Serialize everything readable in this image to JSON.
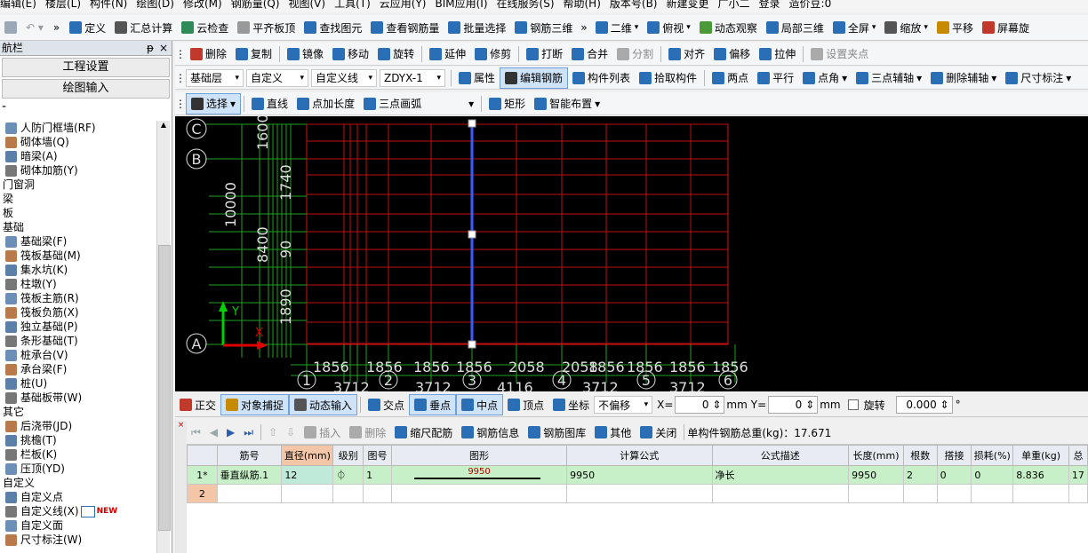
{
  "menubar": [
    "编辑(E)",
    "楼层(L)",
    "构件(N)",
    "绘图(D)",
    "修改(M)",
    "钢筋量(Q)",
    "视图(V)",
    "工具(T)",
    "云应用(Y)",
    "BIM应用(I)",
    "在线服务(S)",
    "帮助(H)",
    "版本号(B)",
    "新建变更",
    "广小二",
    "登录",
    "造价豆:0"
  ],
  "toolbar1": {
    "left": [
      "定义",
      "汇总计算",
      "云检查",
      "平齐板顶",
      "查找图元",
      "查看钢筋量",
      "批量选择",
      "钢筋三维"
    ],
    "right": [
      "二维",
      "俯视",
      "动态观察",
      "局部三维",
      "全屏",
      "缩放",
      "平移",
      "屏幕旋"
    ]
  },
  "panel": {
    "title": "航栏",
    "pin": "ᵽ",
    "close": "×",
    "buttons": [
      "工程设置",
      "绘图输入"
    ],
    "items": [
      {
        "label": "人防门框墙(RF)",
        "type": "item"
      },
      {
        "label": "砌体墙(Q)",
        "type": "item"
      },
      {
        "label": "暗梁(A)",
        "type": "item"
      },
      {
        "label": "砌体加筋(Y)",
        "type": "item"
      },
      {
        "label": "门窗洞",
        "type": "group"
      },
      {
        "label": "梁",
        "type": "group"
      },
      {
        "label": "板",
        "type": "group"
      },
      {
        "label": "基础",
        "type": "group"
      },
      {
        "label": "基础梁(F)",
        "type": "item"
      },
      {
        "label": "筏板基础(M)",
        "type": "item"
      },
      {
        "label": "集水坑(K)",
        "type": "item"
      },
      {
        "label": "柱墩(Y)",
        "type": "item"
      },
      {
        "label": "筏板主筋(R)",
        "type": "item"
      },
      {
        "label": "筏板负筋(X)",
        "type": "item"
      },
      {
        "label": "独立基础(P)",
        "type": "item"
      },
      {
        "label": "条形基础(T)",
        "type": "item"
      },
      {
        "label": "桩承台(V)",
        "type": "item"
      },
      {
        "label": "承台梁(F)",
        "type": "item"
      },
      {
        "label": "桩(U)",
        "type": "item"
      },
      {
        "label": "基础板带(W)",
        "type": "item"
      },
      {
        "label": "其它",
        "type": "group"
      },
      {
        "label": "后浇带(JD)",
        "type": "item"
      },
      {
        "label": "挑檐(T)",
        "type": "item"
      },
      {
        "label": "栏板(K)",
        "type": "item"
      },
      {
        "label": "压顶(YD)",
        "type": "item"
      },
      {
        "label": "自定义",
        "type": "group"
      },
      {
        "label": "自定义点",
        "type": "item"
      },
      {
        "label": "自定义线(X)",
        "type": "item",
        "tag": "NEW"
      },
      {
        "label": "自定义面",
        "type": "item"
      },
      {
        "label": "尺寸标注(W)",
        "type": "item"
      }
    ]
  },
  "toolbar2": [
    "删除",
    "复制",
    "镜像",
    "移动",
    "旋转",
    "延伸",
    "修剪",
    "打断",
    "合并",
    "分割",
    "对齐",
    "偏移",
    "拉伸",
    "设置夹点"
  ],
  "toolbar3": {
    "dropdowns": [
      "基础层",
      "自定义",
      "自定义线",
      "ZDYX-1"
    ],
    "buttons": [
      "属性",
      "编辑钢筋",
      "构件列表",
      "拾取构件",
      "两点",
      "平行",
      "点角",
      "三点辅轴",
      "删除辅轴",
      "尺寸标注"
    ]
  },
  "toolbar4": [
    "选择",
    "直线",
    "点加长度",
    "三点画弧",
    "矩形",
    "智能布置"
  ],
  "canvas": {
    "axis_rows": [
      "C",
      "B",
      "A"
    ],
    "axis_cols": [
      "1",
      "2",
      "3",
      "4",
      "5",
      "6"
    ],
    "top_dims": [
      "1856",
      "1856",
      "1856",
      "1856",
      "2058",
      "2058",
      "1856",
      "1856",
      "1856",
      "1856"
    ],
    "overlap_dim": "185658",
    "bottom_dims": [
      "3712",
      "3712",
      "4116",
      "3712",
      "3712"
    ],
    "left_dims": [
      "1600",
      "10000",
      "8400",
      "1890"
    ],
    "stack_label": "1740",
    "stack_label2": "90",
    "y_label": "Y",
    "x_label": "X"
  },
  "snapbar": {
    "items": [
      "正交",
      "对象捕捉",
      "动态输入",
      "交点",
      "垂点",
      "中点",
      "顶点",
      "坐标"
    ],
    "offset": "不偏移",
    "x_label": "X=",
    "x_value": "0",
    "y_label": "Y=",
    "y_value": "0",
    "unit": "mm",
    "rotate_label": "旋转",
    "rotate_value": "0.000",
    "degree": "°"
  },
  "gridtb": {
    "buttons": [
      "插入",
      "删除",
      "缩尺配筋",
      "钢筋信息",
      "钢筋图库",
      "其他",
      "关闭"
    ],
    "total_label": "单构件钢筋总重(kg)：17.671"
  },
  "table": {
    "headers": [
      "",
      "筋号",
      "直径(mm)",
      "级别",
      "图号",
      "图形",
      "计算公式",
      "公式描述",
      "长度(mm)",
      "根数",
      "搭接",
      "损耗(%)",
      "单重(kg)",
      "总"
    ],
    "rows": [
      [
        "1*",
        "垂直纵筋.1",
        "12",
        "⏀",
        "1",
        "9950",
        "9950",
        "净长",
        "9950",
        "2",
        "0",
        "0",
        "8.836",
        "17"
      ],
      [
        "2",
        "",
        "",
        "",
        "",
        "",
        "",
        "",
        "",
        "",
        "",
        "",
        "",
        ""
      ]
    ]
  }
}
